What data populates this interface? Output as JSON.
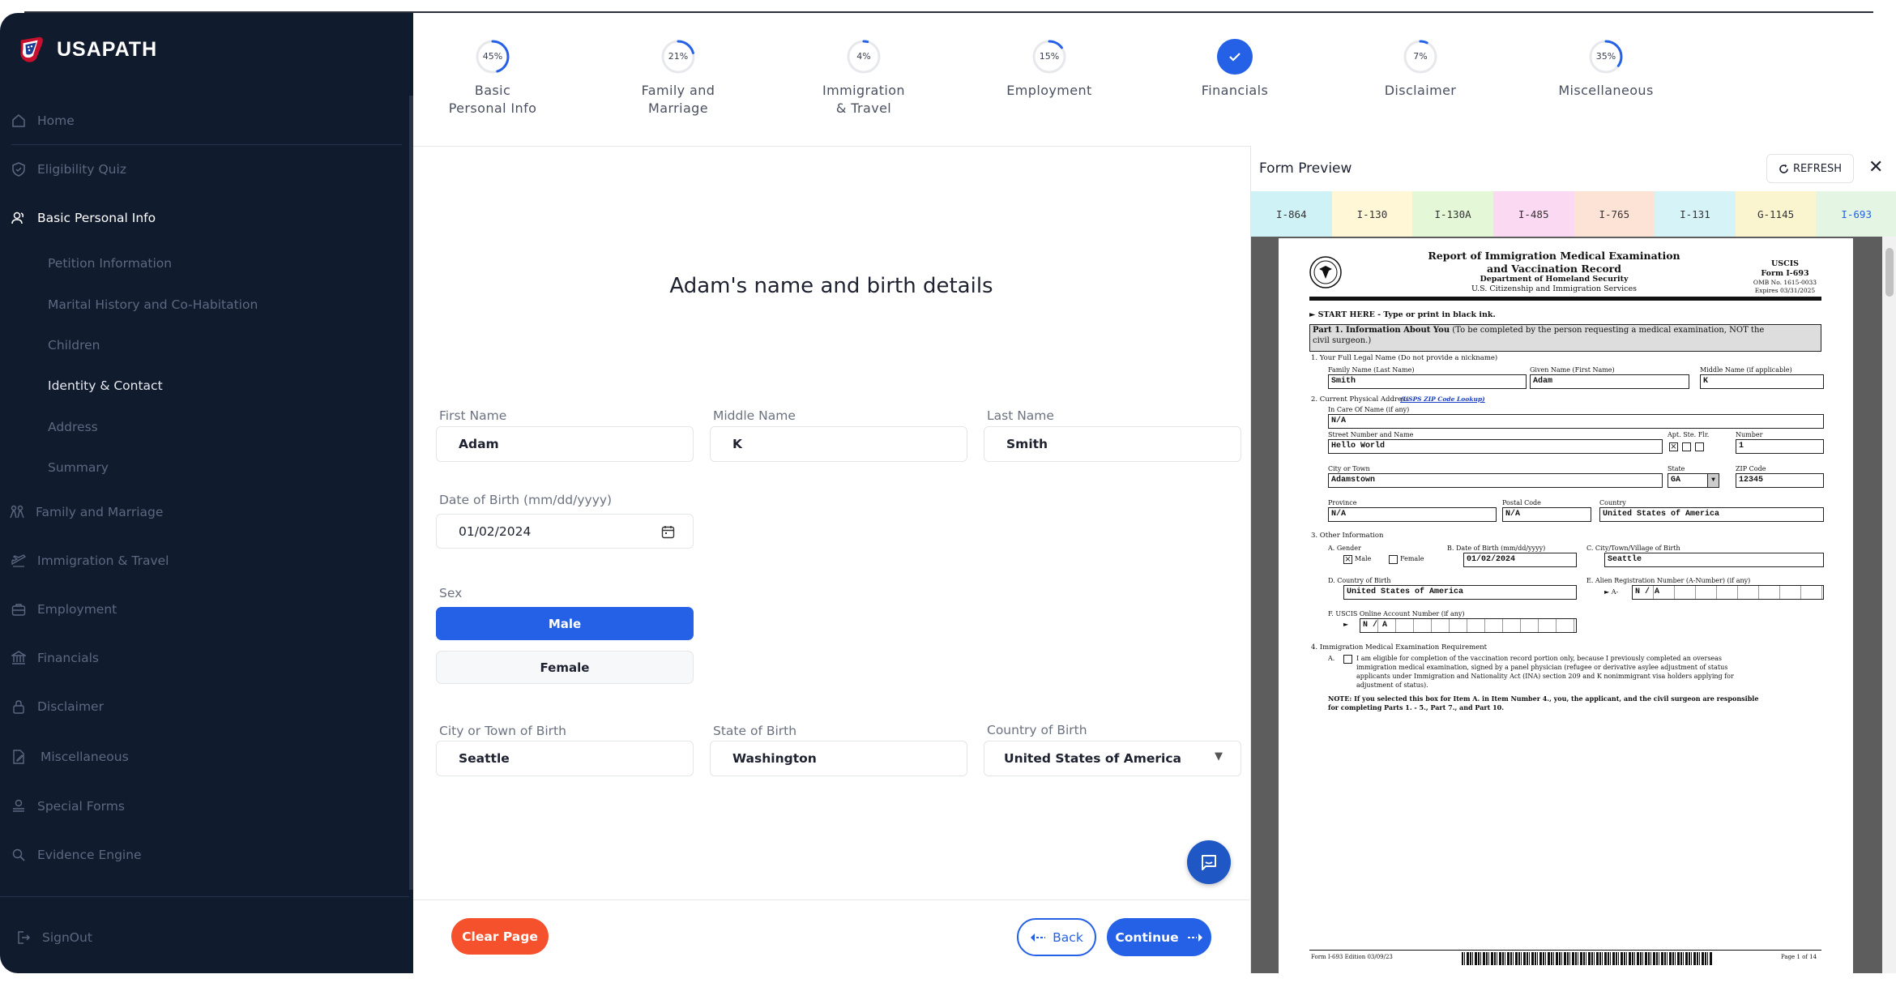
{
  "app": {
    "brand": "USAPATH"
  },
  "sidebar": {
    "items": [
      {
        "label": "Home"
      },
      {
        "label": "Eligibility Quiz"
      },
      {
        "label": "Basic Personal Info"
      },
      {
        "label": "Family and Marriage"
      },
      {
        "label": "Immigration & Travel"
      },
      {
        "label": "Employment"
      },
      {
        "label": "Financials"
      },
      {
        "label": "Disclaimer"
      },
      {
        "label": "Miscellaneous"
      },
      {
        "label": "Special Forms"
      },
      {
        "label": "Evidence Engine"
      },
      {
        "label": "SignOut"
      }
    ],
    "subitems": [
      {
        "label": "Petition Information"
      },
      {
        "label": "Marital History and Co-Habitation"
      },
      {
        "label": "Children"
      },
      {
        "label": "Identity & Contact"
      },
      {
        "label": "Address"
      },
      {
        "label": "Summary"
      }
    ]
  },
  "steps": [
    {
      "pct": "45%",
      "value": 45,
      "line1": "Basic",
      "line2": "Personal Info"
    },
    {
      "pct": "21%",
      "value": 21,
      "line1": "Family and",
      "line2": "Marriage"
    },
    {
      "pct": "4%",
      "value": 4,
      "line1": "Immigration",
      "line2": "& Travel"
    },
    {
      "pct": "15%",
      "value": 15,
      "line1": "Employment",
      "line2": ""
    },
    {
      "pct": "",
      "value": 100,
      "line1": "Financials",
      "line2": ""
    },
    {
      "pct": "7%",
      "value": 7,
      "line1": "Disclaimer",
      "line2": ""
    },
    {
      "pct": "35%",
      "value": 35,
      "line1": "Miscellaneous",
      "line2": ""
    }
  ],
  "form": {
    "title": "Adam's name and birth details",
    "first_name_label": "First Name",
    "first_name": "Adam",
    "middle_name_label": "Middle Name",
    "middle_name": "K",
    "last_name_label": "Last Name",
    "last_name": "Smith",
    "dob_label": "Date of Birth (mm/dd/yyyy)",
    "dob": "01/02/2024",
    "sex_label": "Sex",
    "sex_male": "Male",
    "sex_female": "Female",
    "city_label": "City or Town of Birth",
    "city": "Seattle",
    "state_label": "State of Birth",
    "state": "Washington",
    "country_label": "Country of Birth",
    "country": "United States of America"
  },
  "actions": {
    "clear": "Clear Page",
    "back": "Back",
    "continue": "Continue"
  },
  "preview": {
    "title": "Form Preview",
    "refresh": "REFRESH",
    "tabs": [
      {
        "label": "I-864",
        "color": "#cff2f6"
      },
      {
        "label": "I-130",
        "color": "#fff7d6"
      },
      {
        "label": "I-130A",
        "color": "#e4f7d6"
      },
      {
        "label": "I-485",
        "color": "#fbd9f3"
      },
      {
        "label": "I-765",
        "color": "#fde3d6"
      },
      {
        "label": "I-131",
        "color": "#d6f4f8"
      },
      {
        "label": "G-1145",
        "color": "#fbf5cf"
      },
      {
        "label": "I-693",
        "color": "#e4f5e4"
      }
    ],
    "doc": {
      "title1": "Report of Immigration Medical Examination",
      "title2": "and Vaccination Record",
      "dept": "Department of Homeland Security",
      "agency": "U.S. Citizenship and Immigration Services",
      "r1": "USCIS",
      "r2": "Form I-693",
      "r3": "OMB No. 1615-0033",
      "r4": "Expires 03/31/2025",
      "start": "► START HERE - Type or print in black ink.",
      "part1_bold": "Part 1.  Information About You",
      "part1_rest": " (To be completed by the person requesting a medical examination, NOT the",
      "part1_line2": "civil surgeon.)",
      "q1": "1.    Your Full Legal Name (Do not provide a nickname)",
      "family_name_label": "Family Name (Last Name)",
      "family_name": "Smith",
      "given_name_label": "Given Name (First Name)",
      "given_name": "Adam",
      "middle_label": "Middle Name (if applicable)",
      "middle": "K",
      "q2": "2.    Current Physical Address",
      "usps": "(USPS ZIP Code Lookup)",
      "care_label": "In Care Of Name (if any)",
      "care": "N/A",
      "street_label": "Street Number and Name",
      "street": "Hello World",
      "apt_label": "Apt.  Ste.  Flr.",
      "number_label": "Number",
      "number": "1",
      "city_label": "City or Town",
      "city": "Adamstown",
      "state_label": "State",
      "state": "GA",
      "zip_label": "ZIP Code",
      "zip": "12345",
      "province_label": "Province",
      "province": "N/A",
      "postal_label": "Postal Code",
      "postal": "N/A",
      "country_label": "Country",
      "country": "United States of America",
      "q3": "3.    Other Information",
      "gender_label": "A.    Gender",
      "male": "Male",
      "female": "Female",
      "dob_label": "B.   Date of Birth (mm/dd/yyyy)",
      "dob": "01/02/2024",
      "birthcity_label": "C.    City/Town/Village of Birth",
      "birthcity": "Seattle",
      "birthcountry_label": "D.    Country of Birth",
      "birthcountry": "United States of America",
      "anumber_label": "E.    Alien Registration Number (A-Number) (if any)",
      "anumber": "N  /  A",
      "uscis_label": "F.    USCIS Online Account Number (if any)",
      "uscis": "N  /  A",
      "q4": "4.    Immigration Medical Examination Requirement",
      "q4a1": "I am eligible for completion of the vaccination record portion only, because I previously completed an overseas",
      "q4a2": "immigration medical examination, signed by a panel physician (refugee or derivative asylee adjustment of status",
      "q4a3": "applicants under Immigration and Nationality Act (INA) section 209 and K nonimmigrant visa holders applying for",
      "q4a4": "adjustment of status).",
      "note1": "NOTE:  If you selected this box for Item A. in Item Number 4., you, the applicant, and the civil surgeon are responsible",
      "note2": "for completing Parts 1. - 5., Part 7., and Part 10.",
      "footer_left": "Form I-693   Edition   03/09/23",
      "footer_right": "Page 1 of 14"
    }
  }
}
